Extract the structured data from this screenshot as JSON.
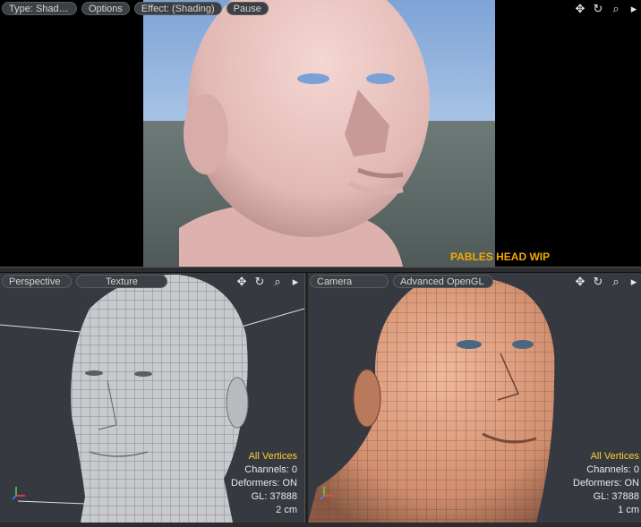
{
  "top_viewport": {
    "toolbar": {
      "type_label": "Type: Shader…",
      "options_label": "Options",
      "effect_label": "Effect: (Shading)",
      "pause_label": "Pause"
    },
    "caption": "PABLES HEAD WIP"
  },
  "bottom_left_viewport": {
    "toolbar": {
      "view_label": "Perspective",
      "shading_label": "Texture"
    },
    "info": {
      "selection": "All Vertices",
      "channels": "Channels: 0",
      "deformers": "Deformers: ON",
      "gl": "GL: 37888",
      "scale": "2 cm"
    }
  },
  "bottom_right_viewport": {
    "toolbar": {
      "view_label": "Camera",
      "shading_label": "Advanced OpenGL"
    },
    "info": {
      "selection": "All Vertices",
      "channels": "Channels: 0",
      "deformers": "Deformers: ON",
      "gl": "GL: 37888",
      "scale": "1 cm"
    }
  },
  "nav_icons": [
    "move-icon",
    "rotate-icon",
    "zoom-icon",
    "more-icon"
  ],
  "colors": {
    "caption": "#f2a900",
    "selection_text": "#ffcc33",
    "viewport_bg": "#363a40"
  }
}
